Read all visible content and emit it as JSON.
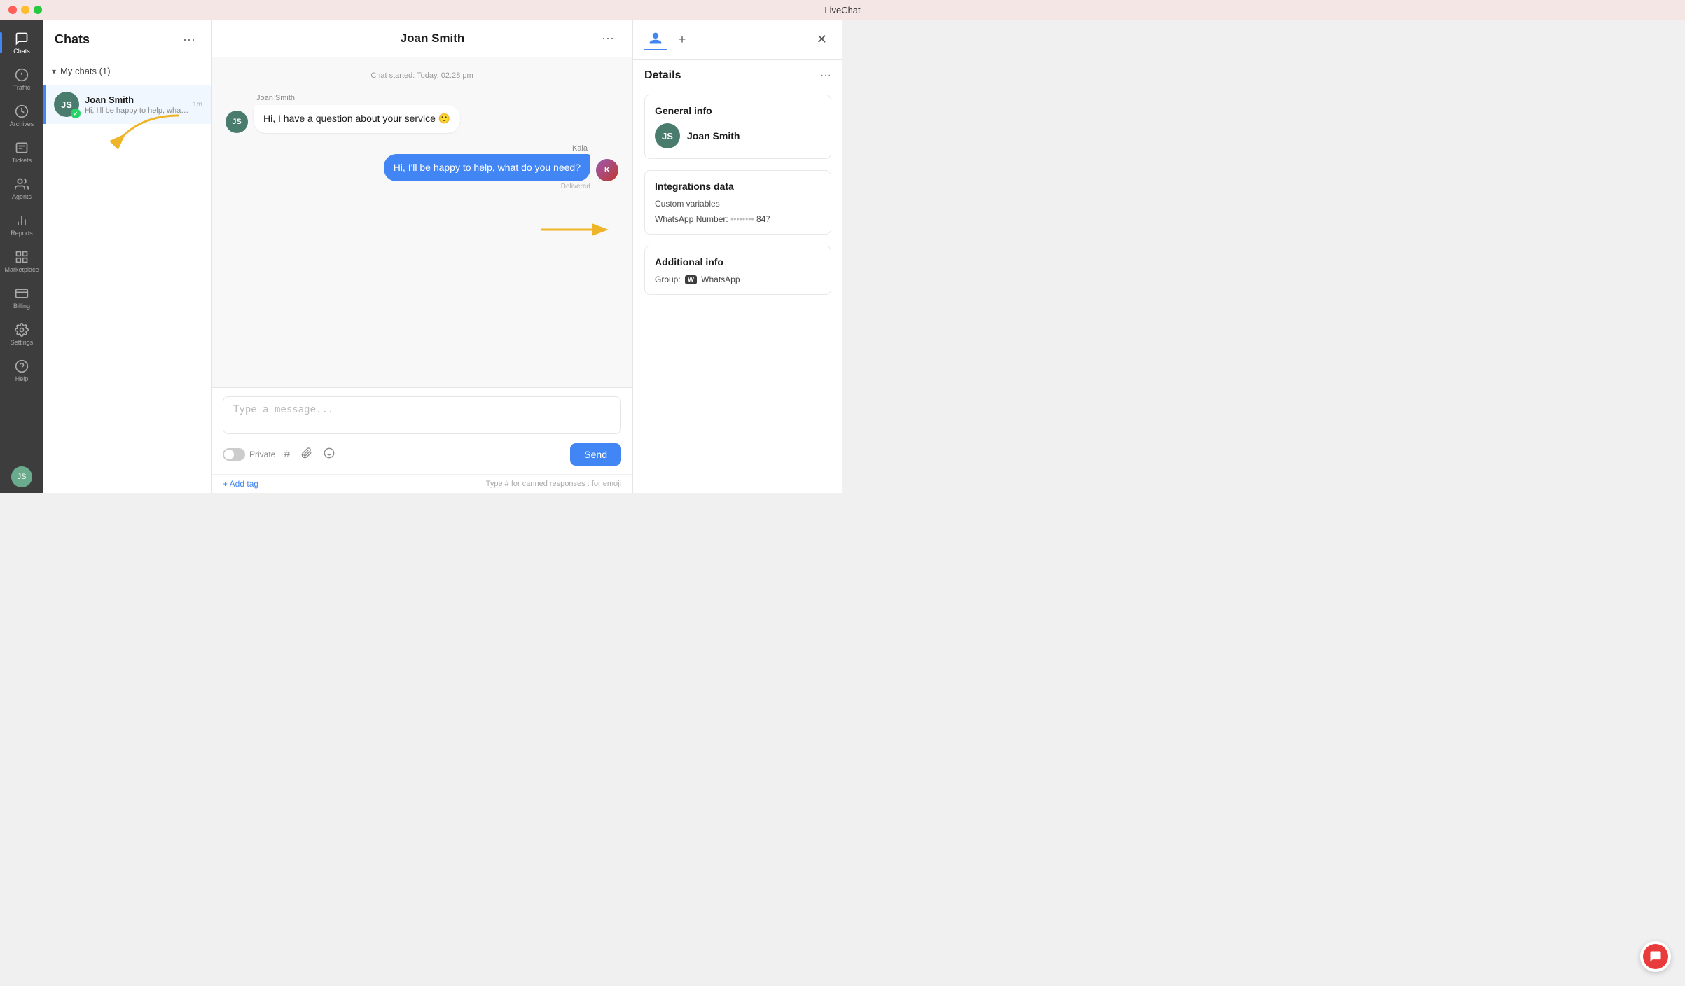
{
  "titleBar": {
    "title": "LiveChat",
    "close": "×",
    "minimize": "−",
    "maximize": "+"
  },
  "sidebar": {
    "items": [
      {
        "id": "chats",
        "label": "Chats",
        "icon": "💬",
        "active": true
      },
      {
        "id": "traffic",
        "label": "Traffic",
        "icon": "📊"
      },
      {
        "id": "archives",
        "label": "Archives",
        "icon": "🕐"
      },
      {
        "id": "tickets",
        "label": "Tickets",
        "icon": "🎫"
      },
      {
        "id": "agents",
        "label": "Agents",
        "icon": "👥"
      },
      {
        "id": "reports",
        "label": "Reports",
        "icon": "📈"
      },
      {
        "id": "marketplace",
        "label": "Marketplace",
        "icon": "⊞"
      },
      {
        "id": "billing",
        "label": "Billing",
        "icon": "⊟"
      },
      {
        "id": "settings",
        "label": "Settings",
        "icon": "⚙"
      },
      {
        "id": "help",
        "label": "Help",
        "icon": "?"
      }
    ],
    "avatarInitials": "JS"
  },
  "chatList": {
    "title": "Chats",
    "menuDots": "···",
    "myChats": {
      "label": "My chats (1)",
      "count": 1
    },
    "items": [
      {
        "id": "joan-smith",
        "name": "Joan Smith",
        "preview": "Hi, I'll be happy to help, what do ...",
        "time": "1m",
        "avatarInitials": "JS",
        "hasWhatsApp": true,
        "active": true
      }
    ]
  },
  "chatWindow": {
    "contactName": "Joan Smith",
    "menuDots": "···",
    "chatStarted": "Chat started: Today, 02:28 pm",
    "messages": [
      {
        "id": 1,
        "sender": "Joan Smith",
        "content": "Hi, I have a question about your service 🙂",
        "type": "incoming",
        "avatarInitials": "JS"
      },
      {
        "id": 2,
        "sender": "Kaia",
        "content": "Hi, I'll be happy to help, what do you need?",
        "type": "outgoing",
        "status": "Delivered"
      }
    ],
    "input": {
      "placeholder": "Type a message...",
      "privateLabel": "Private",
      "sendLabel": "Send"
    },
    "footer": {
      "addTag": "+ Add tag",
      "hint": "Type # for canned responses  : for emoji"
    }
  },
  "detailsPanel": {
    "title": "Details",
    "menuDots": "···",
    "closeBtn": "✕",
    "sections": {
      "generalInfo": {
        "title": "General info",
        "name": "Joan Smith",
        "avatarInitials": "JS"
      },
      "integrationsData": {
        "title": "Integrations data",
        "customVariables": "Custom variables",
        "whatsappLabel": "WhatsApp Number:",
        "whatsappMasked": "••••••••",
        "whatsappSuffix": "847"
      },
      "additionalInfo": {
        "title": "Additional info",
        "groupLabel": "Group:",
        "groupBadge": "W",
        "groupName": "WhatsApp"
      }
    }
  }
}
